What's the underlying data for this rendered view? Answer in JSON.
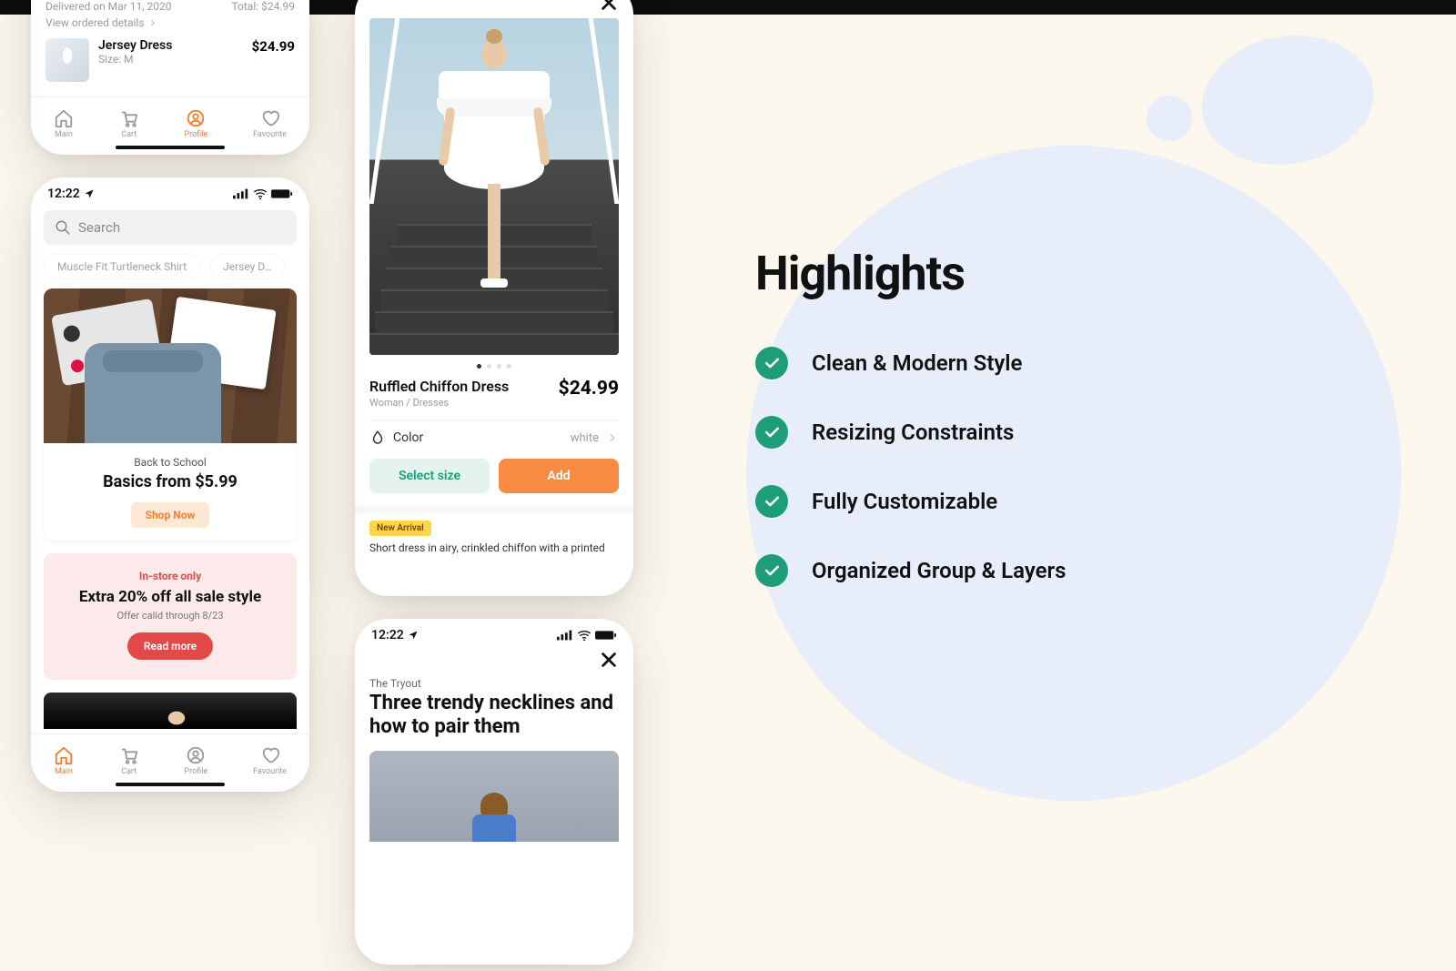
{
  "status": {
    "time": "12:22"
  },
  "phone1": {
    "delivered": "Delivered on Mar 11, 2020",
    "total_label": "Total: $24.99",
    "link": "View ordered details",
    "item": {
      "name": "Jersey Dress",
      "size": "Size: M",
      "price": "$24.99"
    }
  },
  "tabs": {
    "main": "Main",
    "cart": "Cart",
    "profile": "Profile",
    "favourite": "Favourite"
  },
  "search": {
    "placeholder": "Search"
  },
  "chips": [
    "Muscle Fit Turtleneck Shirt",
    "Jersey D…"
  ],
  "promo1": {
    "eyebrow": "Back to School",
    "head": "Basics from $5.99",
    "cta": "Shop Now"
  },
  "promo2": {
    "eyebrow": "In-store only",
    "head": "Extra 20% off all sale style",
    "sub": "Offer calid through 8/23",
    "cta": "Read more"
  },
  "product": {
    "name": "Ruffled Chiffon Dress",
    "category": "Woman / Dresses",
    "price": "$24.99",
    "color_label": "Color",
    "color_value": "white",
    "select_size": "Select size",
    "add": "Add",
    "tag": "New Arrival",
    "desc": "Short dress in airy, crinkled chiffon with a printed"
  },
  "article": {
    "eyebrow": "The Tryout",
    "head": "Three trendy necklines and how to pair them"
  },
  "highlights": {
    "title": "Highlights",
    "items": [
      "Clean & Modern Style",
      "Resizing Constraints",
      "Fully Customizable",
      "Organized Group & Layers"
    ]
  }
}
